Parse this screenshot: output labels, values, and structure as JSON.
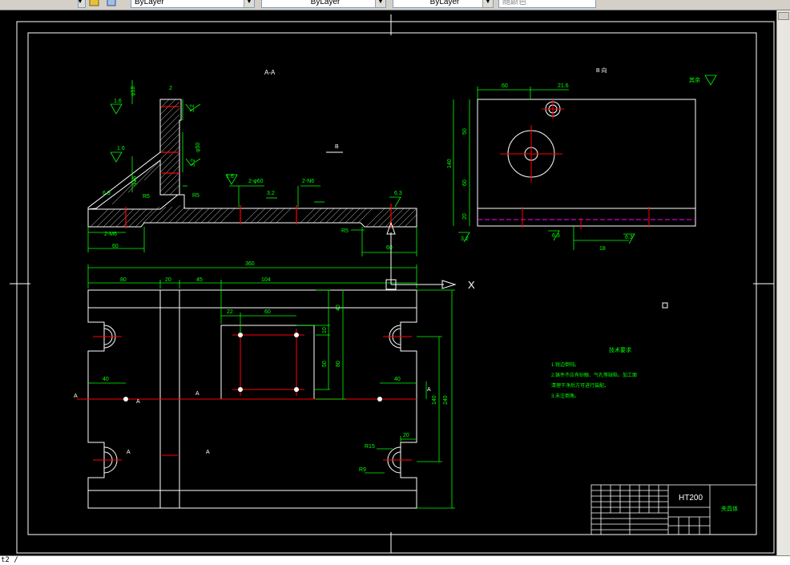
{
  "toolbar": {
    "layer_color_combo": "ByLayer",
    "linetype_combo": "ByLayer",
    "lineweight_combo": "ByLayer",
    "plotstyle_combo": "随颜色"
  },
  "drawing": {
    "section_aa": "A-A",
    "view_b_label": "B 向",
    "view_b_arrow": "B",
    "rest_roughness": "其余",
    "material": "HT200",
    "part_name": "夹具体",
    "tech_req_title": "技术要求",
    "tech_req_1": "1.锐边倒钝。",
    "tech_req_2": "2.铸件不应有砂眼、气孔等缺陷，加工面",
    "tech_req_2b": "清理干净后方可进行装配。",
    "tech_req_3": "3.未注倒角。",
    "ucs_x": "X",
    "dims": {
      "d360": "360",
      "d80": "80",
      "d20": "20",
      "d45": "45",
      "d104": "104",
      "d22": "22",
      "d60": "60",
      "d40a": "40",
      "d40b": "40",
      "d40c": "40",
      "d10": "10",
      "d50": "50",
      "d80v": "80",
      "d140": "140",
      "d240": "240",
      "d20b": "20",
      "r15": "R15",
      "r9": "R9",
      "d60a": "60",
      "d60b": "60",
      "d2m6": "2-M6",
      "r5a": "R5",
      "r5b": "R5",
      "r5c": "R5",
      "r63a": "6.3",
      "r63b": "6.3",
      "r63c": "6.3",
      "r63d": "6.3",
      "r16a": "1.6",
      "r16b": "1.6",
      "r16c": "1.6",
      "r32a": "3.2",
      "r32b": "3.2",
      "r32c": "3.2",
      "phi50": "φ50",
      "phi18": "φ18",
      "phi16": "φ16",
      "phi60": "2-φ60",
      "d2n6": "2-N6",
      "bv60": "60",
      "bv216": "21.6",
      "bv140": "140",
      "bv50": "50",
      "bv60v": "60",
      "bv20": "20",
      "bv18": "18",
      "d2": "2"
    }
  },
  "command_line": {
    "text": "t2 /"
  },
  "colors": {
    "background": "#000000",
    "geometry": "#ffffff",
    "dimension": "#00ff00",
    "centerline": "#ff0000",
    "hidden": "#ff00ff"
  }
}
